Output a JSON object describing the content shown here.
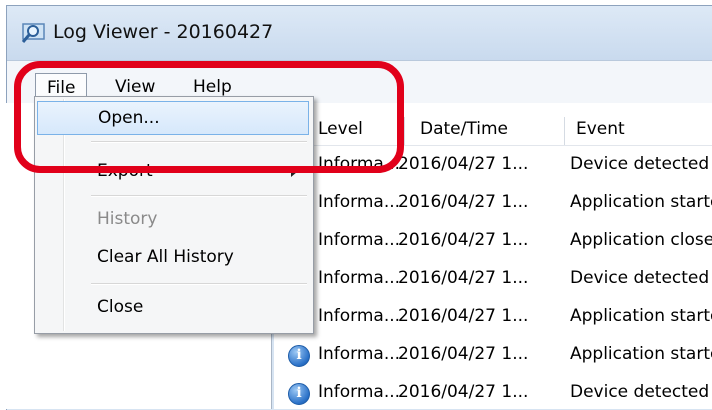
{
  "window": {
    "title": "Log Viewer - 20160427"
  },
  "menubar": {
    "file": "File",
    "view": "View",
    "help": "Help"
  },
  "file_menu": {
    "open": "Open...",
    "export": "Export",
    "history": "History",
    "clear_all_history": "Clear All History",
    "close": "Close"
  },
  "grid": {
    "columns": {
      "level": "Level",
      "datetime": "Date/Time",
      "event": "Event"
    },
    "rows": [
      {
        "level": "Informa...",
        "datetime": "2016/04/27 1...",
        "event": "Device detected"
      },
      {
        "level": "Informa...",
        "datetime": "2016/04/27 1...",
        "event": "Application started"
      },
      {
        "level": "Informa...",
        "datetime": "2016/04/27 1...",
        "event": "Application closed"
      },
      {
        "level": "Informa...",
        "datetime": "2016/04/27 1...",
        "event": "Device detected"
      },
      {
        "level": "Informa...",
        "datetime": "2016/04/27 1...",
        "event": "Application started"
      },
      {
        "level": "Informa...",
        "datetime": "2016/04/27 1...",
        "event": "Application started"
      },
      {
        "level": "Informa...",
        "datetime": "2016/04/27 1...",
        "event": "Device detected"
      }
    ]
  },
  "colors": {
    "highlight_circle": "#e1001a",
    "menu_hover": "#d6e8fb",
    "info_icon": "#2a71c8"
  }
}
